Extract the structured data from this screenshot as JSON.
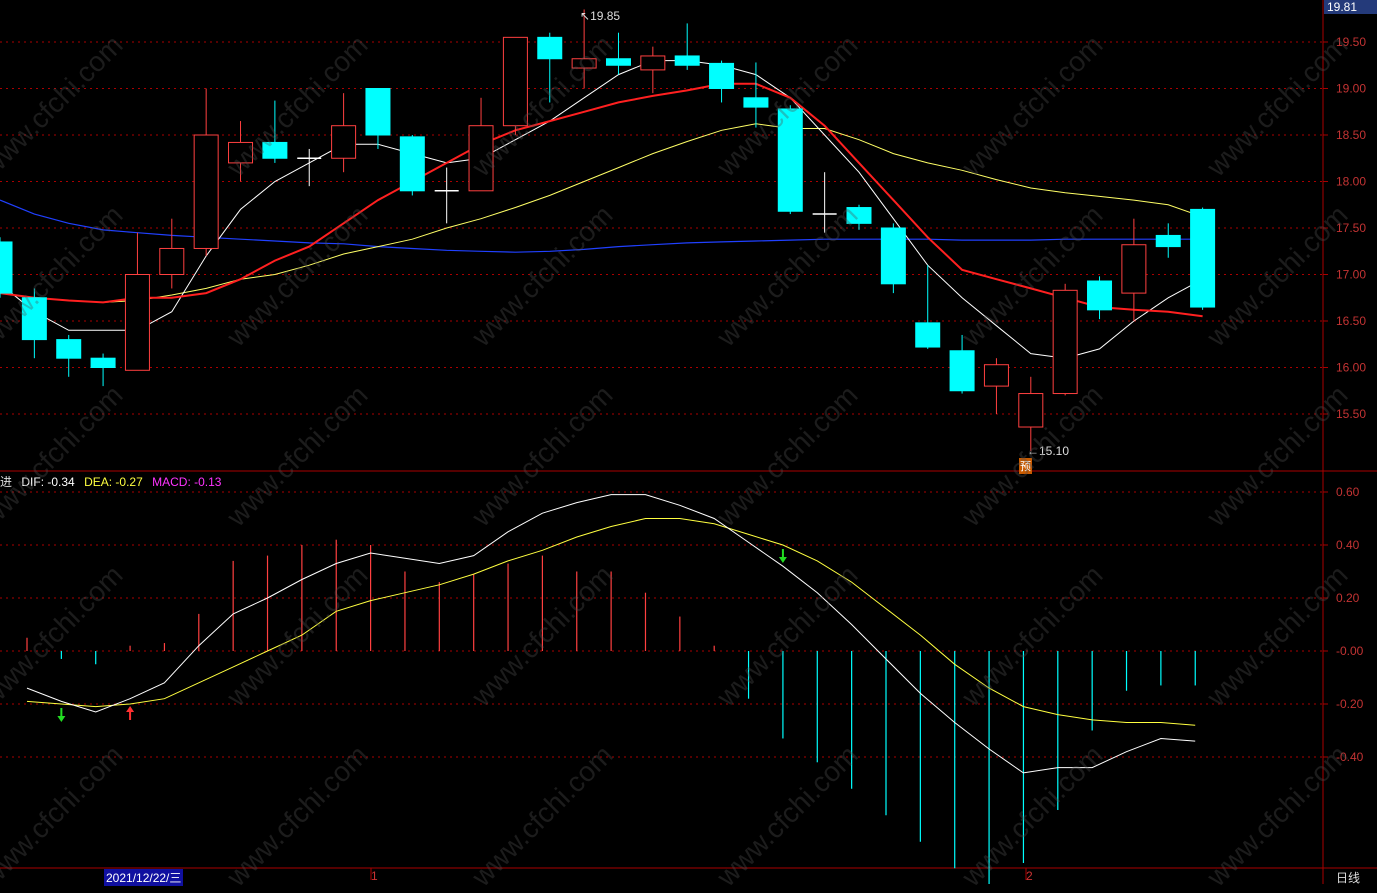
{
  "price_box_value": "19.81",
  "period_label": "日线",
  "date_marker": "2021/12/22/三",
  "bottom_month_ticks": [
    "1",
    "2"
  ],
  "high_marker": "19.85",
  "low_marker": "15.10",
  "pre_tag": "预",
  "macd_legend": {
    "prefix": "进",
    "dif_label": "DIF: -0.34",
    "dea_label": "DEA: -0.27",
    "macd_label": "MACD: -0.13"
  },
  "watermark_text": "www.cfchi.com",
  "colors": {
    "up": "#ff4040",
    "down": "#00ffff",
    "ma5": "#ffffff",
    "ma10": "#ff2020",
    "ma20": "#ffff66",
    "ma60": "#2040ff",
    "dif": "#ffffff",
    "dea": "#ffff40",
    "macd_legend": "#ff00ff",
    "axis_text": "#c33333",
    "grid": "#aa0000"
  },
  "chart_data": [
    {
      "type": "candlestick",
      "y_ticks": [
        "19.50",
        "19.00",
        "18.50",
        "18.00",
        "17.50",
        "17.00",
        "16.50",
        "16.00",
        "15.50"
      ],
      "ylim": [
        15.0,
        19.9
      ],
      "candles": [
        {
          "o": 17.35,
          "h": 17.4,
          "l": 16.75,
          "c": 16.8
        },
        {
          "o": 16.75,
          "h": 16.85,
          "l": 16.1,
          "c": 16.3
        },
        {
          "o": 16.3,
          "h": 16.35,
          "l": 15.9,
          "c": 16.1
        },
        {
          "o": 16.1,
          "h": 16.15,
          "l": 15.8,
          "c": 16.0
        },
        {
          "o": 15.97,
          "h": 17.45,
          "l": 15.97,
          "c": 17.0
        },
        {
          "o": 17.0,
          "h": 17.6,
          "l": 16.85,
          "c": 17.28
        },
        {
          "o": 17.28,
          "h": 19.0,
          "l": 17.2,
          "c": 18.5
        },
        {
          "o": 18.2,
          "h": 18.65,
          "l": 18.0,
          "c": 18.42
        },
        {
          "o": 18.42,
          "h": 18.87,
          "l": 18.2,
          "c": 18.25
        },
        {
          "o": 18.25,
          "h": 18.35,
          "l": 17.95,
          "c": 18.25
        },
        {
          "o": 18.25,
          "h": 18.95,
          "l": 18.1,
          "c": 18.6
        },
        {
          "o": 19.0,
          "h": 19.0,
          "l": 18.35,
          "c": 18.5
        },
        {
          "o": 18.48,
          "h": 18.5,
          "l": 17.85,
          "c": 17.9
        },
        {
          "o": 17.9,
          "h": 18.15,
          "l": 17.55,
          "c": 17.9
        },
        {
          "o": 17.9,
          "h": 18.9,
          "l": 17.9,
          "c": 18.6
        },
        {
          "o": 18.6,
          "h": 19.55,
          "l": 18.5,
          "c": 19.55
        },
        {
          "o": 19.55,
          "h": 19.6,
          "l": 18.85,
          "c": 19.32
        },
        {
          "o": 19.22,
          "h": 19.85,
          "l": 19.0,
          "c": 19.32
        },
        {
          "o": 19.32,
          "h": 19.6,
          "l": 19.15,
          "c": 19.25
        },
        {
          "o": 19.2,
          "h": 19.45,
          "l": 18.95,
          "c": 19.35
        },
        {
          "o": 19.35,
          "h": 19.7,
          "l": 19.2,
          "c": 19.25
        },
        {
          "o": 19.27,
          "h": 19.3,
          "l": 18.85,
          "c": 19.0
        },
        {
          "o": 18.9,
          "h": 19.28,
          "l": 18.58,
          "c": 18.8
        },
        {
          "o": 18.78,
          "h": 18.82,
          "l": 17.65,
          "c": 17.68
        },
        {
          "o": 17.65,
          "h": 18.1,
          "l": 17.45,
          "c": 17.65
        },
        {
          "o": 17.72,
          "h": 17.75,
          "l": 17.48,
          "c": 17.55
        },
        {
          "o": 17.5,
          "h": 17.55,
          "l": 16.8,
          "c": 16.9
        },
        {
          "o": 16.48,
          "h": 17.1,
          "l": 16.2,
          "c": 16.22
        },
        {
          "o": 16.18,
          "h": 16.35,
          "l": 15.72,
          "c": 15.75
        },
        {
          "o": 15.8,
          "h": 16.1,
          "l": 15.5,
          "c": 16.03
        },
        {
          "o": 15.36,
          "h": 15.9,
          "l": 15.1,
          "c": 15.72
        },
        {
          "o": 15.72,
          "h": 16.9,
          "l": 15.7,
          "c": 16.83
        },
        {
          "o": 16.93,
          "h": 16.98,
          "l": 16.52,
          "c": 16.62
        },
        {
          "o": 16.8,
          "h": 17.6,
          "l": 16.5,
          "c": 17.32
        },
        {
          "o": 17.42,
          "h": 17.55,
          "l": 17.18,
          "c": 17.3
        },
        {
          "o": 17.7,
          "h": 17.72,
          "l": 16.62,
          "c": 16.65
        }
      ],
      "ma5": [
        16.9,
        16.6,
        16.4,
        16.4,
        16.4,
        16.6,
        17.2,
        17.7,
        18.0,
        18.2,
        18.4,
        18.4,
        18.3,
        18.2,
        18.25,
        18.45,
        18.65,
        18.9,
        19.15,
        19.3,
        19.3,
        19.25,
        19.15,
        18.9,
        18.5,
        18.1,
        17.6,
        17.1,
        16.75,
        16.45,
        16.15,
        16.1,
        16.2,
        16.5,
        16.75,
        16.95
      ],
      "ma10": [
        16.8,
        16.75,
        16.72,
        16.7,
        16.75,
        16.75,
        16.8,
        16.95,
        17.15,
        17.3,
        17.55,
        17.8,
        18.0,
        18.2,
        18.4,
        18.55,
        18.65,
        18.75,
        18.85,
        18.92,
        18.98,
        19.05,
        19.05,
        18.9,
        18.6,
        18.2,
        17.8,
        17.4,
        17.05,
        16.95,
        16.85,
        16.75,
        16.65,
        16.62,
        16.6,
        16.55
      ],
      "ma20": [
        16.8,
        16.75,
        16.72,
        16.7,
        16.72,
        16.78,
        16.85,
        16.95,
        17.0,
        17.1,
        17.22,
        17.3,
        17.38,
        17.5,
        17.6,
        17.72,
        17.85,
        18.0,
        18.15,
        18.3,
        18.43,
        18.55,
        18.62,
        18.57,
        18.57,
        18.45,
        18.3,
        18.2,
        18.12,
        18.02,
        17.93,
        17.88,
        17.84,
        17.8,
        17.75,
        17.62
      ],
      "ma60": [
        17.8,
        17.65,
        17.55,
        17.48,
        17.45,
        17.42,
        17.4,
        17.38,
        17.36,
        17.34,
        17.33,
        17.3,
        17.28,
        17.26,
        17.25,
        17.24,
        17.25,
        17.27,
        17.3,
        17.32,
        17.34,
        17.35,
        17.36,
        17.37,
        17.38,
        17.38,
        17.38,
        17.38,
        17.37,
        17.37,
        17.37,
        17.38,
        17.38,
        17.38,
        17.38,
        17.38
      ]
    },
    {
      "type": "macd",
      "y_ticks": [
        "0.60",
        "0.40",
        "0.20",
        "-0.00",
        "-0.20",
        "-0.40"
      ],
      "ylim": [
        -0.8,
        0.68
      ],
      "dif": [
        -0.14,
        -0.19,
        -0.23,
        -0.18,
        -0.12,
        0.02,
        0.14,
        0.2,
        0.27,
        0.33,
        0.37,
        0.35,
        0.33,
        0.36,
        0.45,
        0.52,
        0.56,
        0.59,
        0.59,
        0.55,
        0.5,
        0.41,
        0.32,
        0.22,
        0.1,
        -0.03,
        -0.16,
        -0.27,
        -0.37,
        -0.46,
        -0.44,
        -0.44,
        -0.38,
        -0.33,
        -0.34
      ],
      "dea": [
        -0.19,
        -0.2,
        -0.21,
        -0.2,
        -0.18,
        -0.12,
        -0.06,
        0.0,
        0.06,
        0.15,
        0.19,
        0.22,
        0.25,
        0.29,
        0.34,
        0.38,
        0.43,
        0.47,
        0.5,
        0.5,
        0.48,
        0.44,
        0.4,
        0.34,
        0.26,
        0.16,
        0.06,
        -0.05,
        -0.14,
        -0.21,
        -0.24,
        -0.26,
        -0.27,
        -0.27,
        -0.28
      ],
      "macd": [
        0.05,
        -0.03,
        -0.05,
        0.02,
        0.03,
        0.14,
        0.34,
        0.36,
        0.4,
        0.42,
        0.4,
        0.3,
        0.26,
        0.29,
        0.33,
        0.36,
        0.3,
        0.3,
        0.22,
        0.13,
        0.02,
        -0.18,
        -0.33,
        -0.42,
        -0.52,
        -0.62,
        -0.72,
        -0.82,
        -0.88,
        -0.8,
        -0.6,
        -0.3,
        -0.15,
        -0.13,
        -0.13
      ],
      "cross_arrows": [
        {
          "index": 1,
          "kind": "down"
        },
        {
          "index": 3,
          "kind": "up"
        },
        {
          "index": 22,
          "kind": "down"
        }
      ]
    }
  ]
}
